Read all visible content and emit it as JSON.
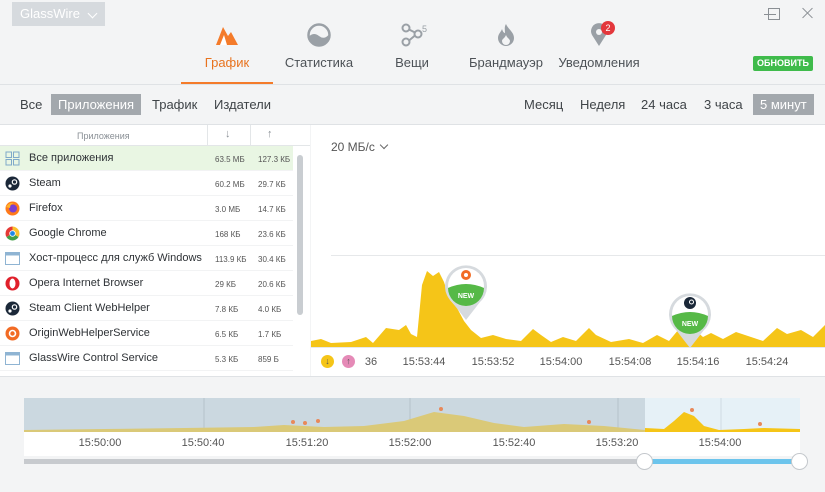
{
  "titlebar": {
    "app_name": "GlassWire"
  },
  "nav": {
    "tabs": [
      {
        "label": "График"
      },
      {
        "label": "Статистика"
      },
      {
        "label": "Вещи",
        "count": "5"
      },
      {
        "label": "Брандмауэр"
      },
      {
        "label": "Уведомления",
        "badge": "2"
      }
    ],
    "update_label": "ОБНОВИТЬ"
  },
  "filters": {
    "left": [
      "Все",
      "Приложения",
      "Трафик",
      "Издатели"
    ],
    "left_active": "Приложения",
    "right": [
      "Месяц",
      "Неделя",
      "24 часа",
      "3 часа",
      "5 минут"
    ],
    "right_active": "5 минут"
  },
  "list": {
    "header_name": "Приложения",
    "header_down": "↓",
    "header_up": "↑",
    "rows": [
      {
        "name": "Все приложения",
        "down": "63.5 МБ",
        "up": "127.3 КБ",
        "icon": "all-apps-icon"
      },
      {
        "name": "Steam",
        "down": "60.2 МБ",
        "up": "29.7 КБ",
        "icon": "steam-icon"
      },
      {
        "name": "Firefox",
        "down": "3.0 МБ",
        "up": "14.7 КБ",
        "icon": "firefox-icon"
      },
      {
        "name": "Google Chrome",
        "down": "168 КБ",
        "up": "23.6 КБ",
        "icon": "chrome-icon"
      },
      {
        "name": "Хост-процесс для служб Windows",
        "down": "113.9 КБ",
        "up": "30.4 КБ",
        "icon": "window-icon"
      },
      {
        "name": "Opera Internet Browser",
        "down": "29 КБ",
        "up": "20.6 КБ",
        "icon": "opera-icon"
      },
      {
        "name": "Steam Client WebHelper",
        "down": "7.8 КБ",
        "up": "4.0 КБ",
        "icon": "steam-icon"
      },
      {
        "name": "OriginWebHelperService",
        "down": "6.5 КБ",
        "up": "1.7 КБ",
        "icon": "origin-icon"
      },
      {
        "name": "GlassWire Control Service",
        "down": "5.3 КБ",
        "up": "859 Б",
        "icon": "window-icon"
      }
    ]
  },
  "graph": {
    "scale_label": "20 МБ/с",
    "axis_ticks": [
      "36",
      "15:53:44",
      "15:53:52",
      "15:54:00",
      "15:54:08",
      "15:54:16",
      "15:54:24"
    ],
    "markers": [
      {
        "label": "NEW",
        "app": "origin-icon"
      },
      {
        "label": "NEW",
        "app": "steam-icon"
      }
    ],
    "colors": {
      "download": "#f5c518",
      "upload": "#e58ab7"
    }
  },
  "timeline": {
    "ticks": [
      "15:50:00",
      "15:50:40",
      "15:51:20",
      "15:52:00",
      "15:52:40",
      "15:53:20",
      "15:54:00"
    ]
  }
}
